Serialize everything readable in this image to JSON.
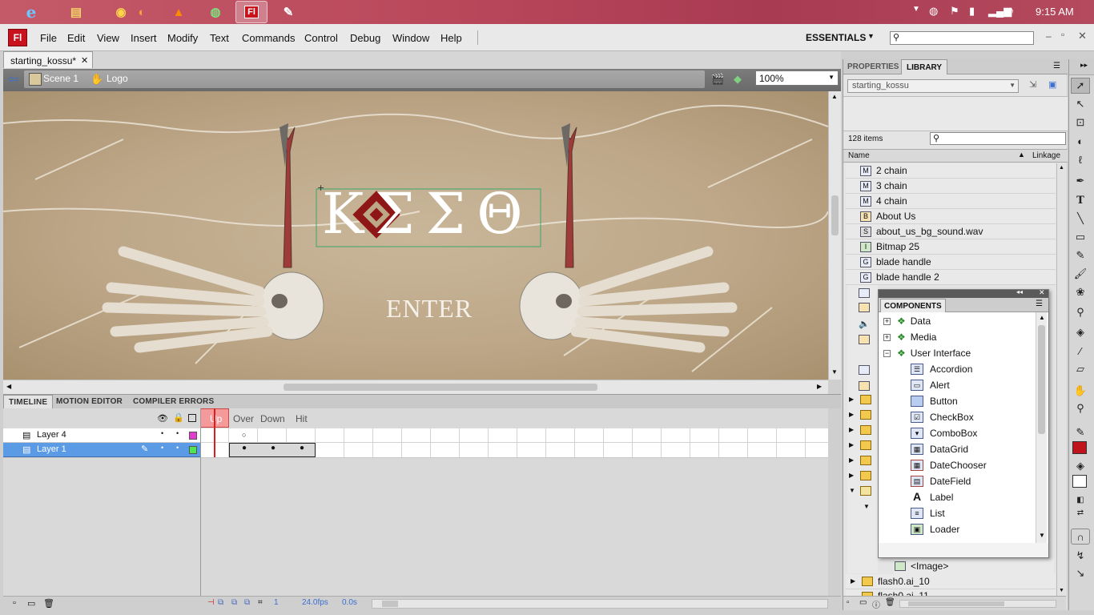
{
  "taskbar": {
    "apps": [
      {
        "name": "internet-explorer",
        "glyph": "e"
      },
      {
        "name": "file-explorer",
        "glyph": "▤"
      },
      {
        "name": "chrome",
        "glyph": "◉"
      },
      {
        "name": "firefox",
        "glyph": "◐"
      },
      {
        "name": "vlc",
        "glyph": "▲"
      },
      {
        "name": "globe-app",
        "glyph": "◍"
      },
      {
        "name": "flash",
        "glyph": "Fl"
      },
      {
        "name": "paint",
        "glyph": "✎"
      }
    ],
    "clock": "9:15 AM"
  },
  "menubar": {
    "logo": "Fl",
    "items": [
      "File",
      "Edit",
      "View",
      "Insert",
      "Modify",
      "Text",
      "Commands",
      "Control",
      "Debug",
      "Window",
      "Help"
    ],
    "workspace": "ESSENTIALS",
    "search_placeholder": ""
  },
  "document": {
    "tab": "starting_kossu*",
    "scene": "Scene 1",
    "symbol": "Logo",
    "zoom": "100%"
  },
  "stage": {
    "logo_text": "ΚΣΣΘ",
    "enter_text": "ENTER"
  },
  "timeline": {
    "tabs": [
      "TIMELINE",
      "MOTION EDITOR",
      "COMPILER ERRORS"
    ],
    "frame_labels": [
      "Up",
      "Over",
      "Down",
      "Hit"
    ],
    "layers": [
      "Layer 4",
      "Layer 1"
    ],
    "current_frame": "1",
    "fps": "24.0fps",
    "time": "0.0s"
  },
  "panel": {
    "tabs": [
      "PROPERTIES",
      "LIBRARY"
    ],
    "library_name": "starting_kossu",
    "item_count": "128 items",
    "col_name": "Name",
    "col_linkage": "Linkage",
    "items": [
      {
        "label": "2 chain",
        "icon": "M"
      },
      {
        "label": "3 chain",
        "icon": "M"
      },
      {
        "label": "4 chain",
        "icon": "M"
      },
      {
        "label": "About Us",
        "icon": "B"
      },
      {
        "label": "about_us_bg_sound.wav",
        "icon": "S"
      },
      {
        "label": "Bitmap 25",
        "icon": "I"
      },
      {
        "label": "blade handle",
        "icon": "G"
      },
      {
        "label": "blade handle 2",
        "icon": "G"
      }
    ],
    "bottom_items": [
      "<Image>",
      "flash0.ai_10",
      "flash0.ai_11"
    ]
  },
  "components": {
    "title": "COMPONENTS",
    "groups": [
      "Data",
      "Media",
      "User Interface"
    ],
    "ui_items": [
      "Accordion",
      "Alert",
      "Button",
      "CheckBox",
      "ComboBox",
      "DataGrid",
      "DateChooser",
      "DateField",
      "Label",
      "List",
      "Loader"
    ]
  },
  "colors": {
    "accent_flash": "#c8121c",
    "playhead": "#e21a1a",
    "selected_layer": "#5b9be6",
    "stroke_swatch": "#c0141c",
    "fill_swatch": "#ffffff"
  }
}
